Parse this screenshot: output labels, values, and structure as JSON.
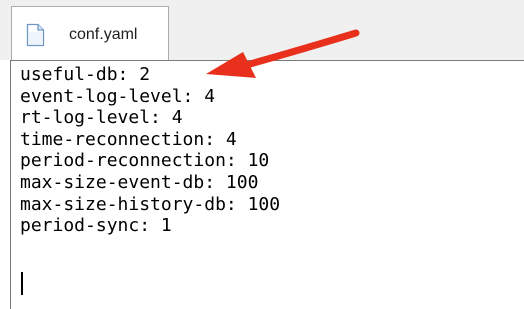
{
  "tab": {
    "label": "conf.yaml",
    "icon": "document-icon"
  },
  "editor": {
    "lines": [
      "useful-db: 2",
      "event-log-level: 4",
      "rt-log-level: 4",
      "time-reconnection: 4",
      "period-reconnection: 10",
      "max-size-event-db: 100",
      "max-size-history-db: 100",
      "period-sync: 1"
    ]
  },
  "annotation": {
    "arrow_color": "#e8301c",
    "icon": "arrow-icon"
  }
}
